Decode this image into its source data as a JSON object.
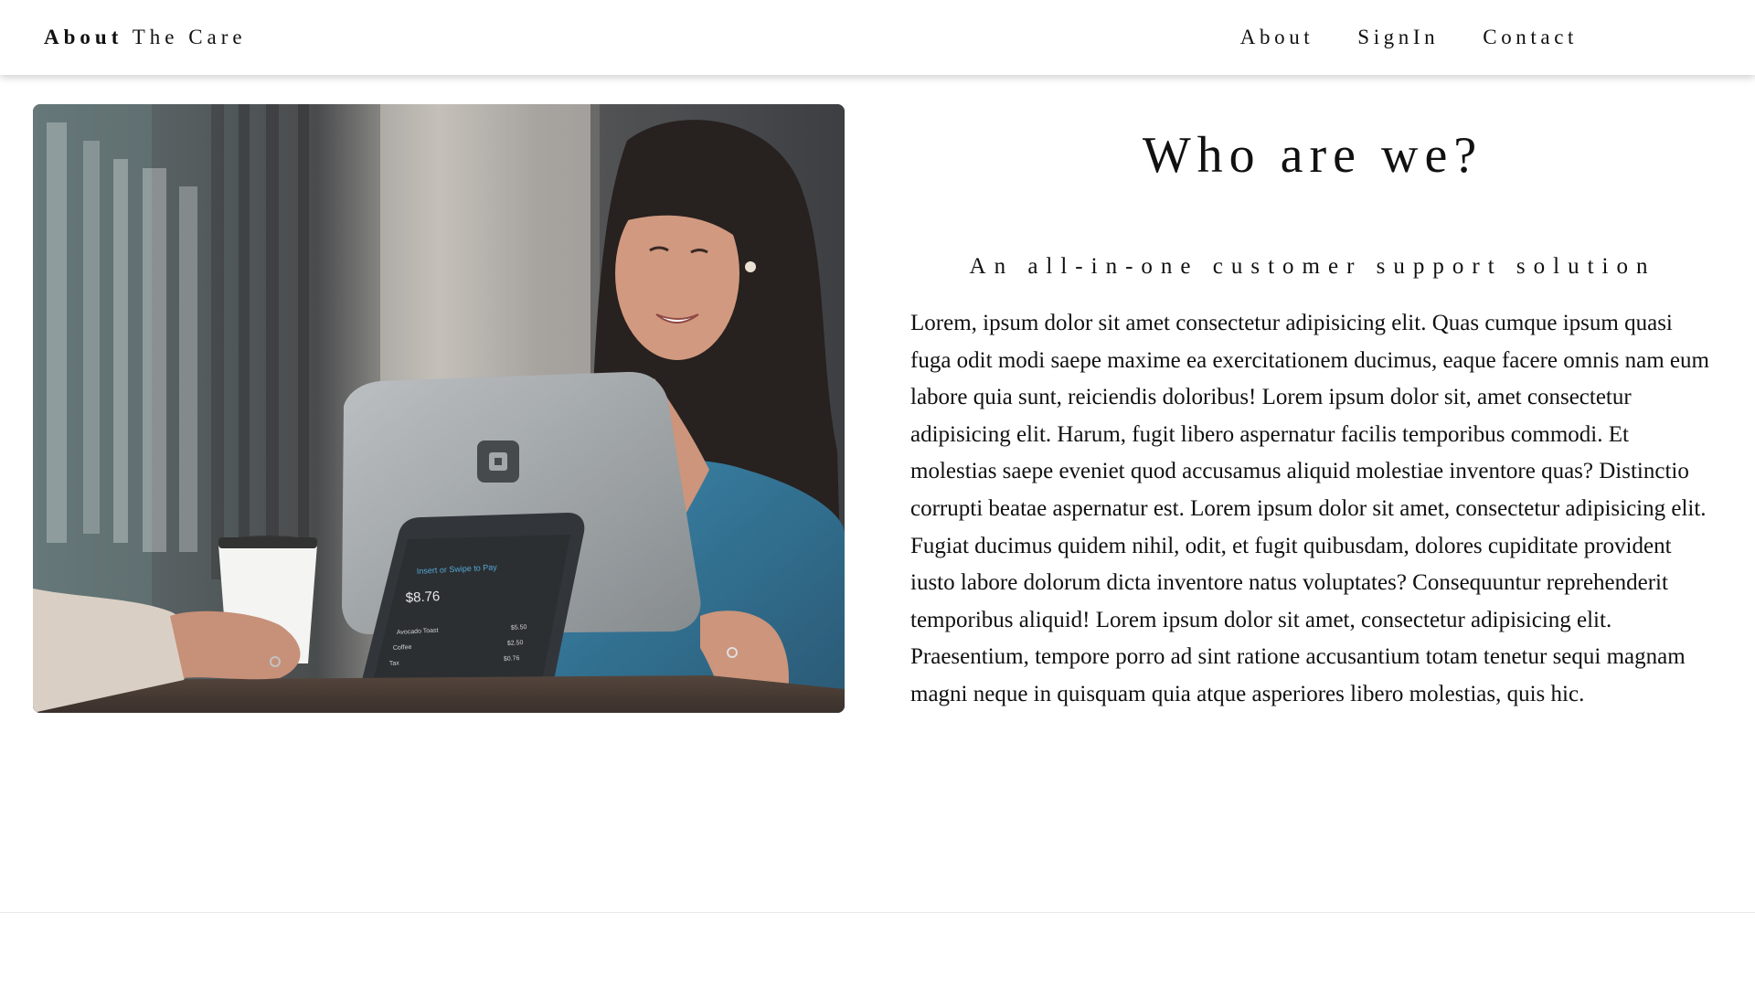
{
  "navbar": {
    "brand_bold": "About",
    "brand_rest": " The Care",
    "links": [
      "About",
      "SignIn",
      "Contact"
    ]
  },
  "hero_image": {
    "alt": "Smiling woman at a cafe counter with a tablet point-of-sale stand and a coffee cup",
    "screen_amount": "$8.76",
    "screen_header": "Insert or Swipe to Pay",
    "screen_items": [
      {
        "name": "Avocado Toast",
        "price": "$5.50"
      },
      {
        "name": "Coffee",
        "price": "$2.50"
      },
      {
        "name": "Tax",
        "price": "$0.76"
      }
    ]
  },
  "about": {
    "heading": "Who are we?",
    "subheading": "An all-in-one customer support solution",
    "body": "Lorem, ipsum dolor sit amet consectetur adipisicing elit. Quas cumque ipsum quasi fuga odit modi saepe maxime ea exercitationem ducimus, eaque facere omnis nam eum labore quia sunt, reiciendis doloribus! Lorem ipsum dolor sit, amet consectetur adipisicing elit. Harum, fugit libero aspernatur facilis temporibus commodi. Et molestias saepe eveniet quod accusamus aliquid molestiae inventore quas? Distinctio corrupti beatae aspernatur est. Lorem ipsum dolor sit amet, consectetur adipisicing elit. Fugiat ducimus quidem nihil, odit, et fugit quibusdam, dolores cupiditate provident iusto labore dolorum dicta inventore natus voluptates? Consequuntur reprehenderit temporibus aliquid! Lorem ipsum dolor sit amet, consectetur adipisicing elit. Praesentium, tempore porro ad sint ratione accusantium totam tenetur sequi magnam magni neque in quisquam quia atque asperiores libero molestias, quis hic."
  },
  "colors": {
    "text": "#111111",
    "background": "#ffffff",
    "shirt": "#2a6f95"
  }
}
